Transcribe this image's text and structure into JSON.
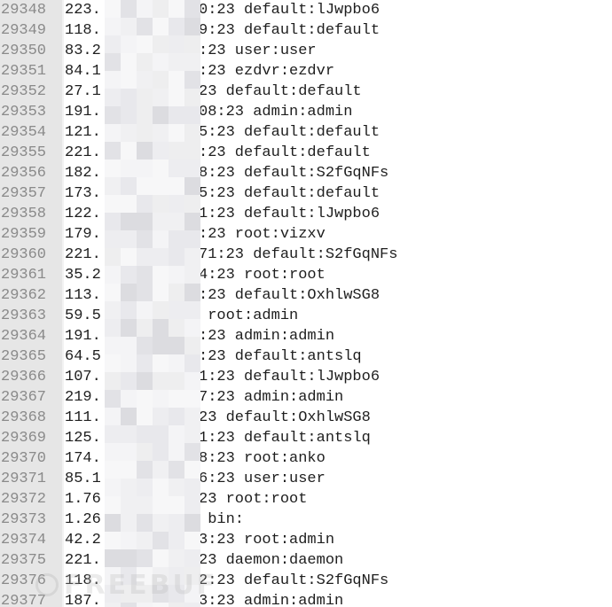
{
  "rows": [
    {
      "line": "29348",
      "ip": "223.",
      "rest": "0:23 default:lJwpbo6"
    },
    {
      "line": "29349",
      "ip": "118.",
      "rest": "9:23 default:default"
    },
    {
      "line": "29350",
      "ip": "83.2",
      "rest": ":23 user:user"
    },
    {
      "line": "29351",
      "ip": "84.1",
      "rest": ":23 ezdvr:ezdvr"
    },
    {
      "line": "29352",
      "ip": "27.1",
      "rest": "23 default:default"
    },
    {
      "line": "29353",
      "ip": "191.",
      "rest": "08:23 admin:admin"
    },
    {
      "line": "29354",
      "ip": "121.",
      "rest": "5:23 default:default"
    },
    {
      "line": "29355",
      "ip": "221.",
      "rest": ":23 default:default"
    },
    {
      "line": "29356",
      "ip": "182.",
      "rest": "8:23 default:S2fGqNFs"
    },
    {
      "line": "29357",
      "ip": "173.",
      "rest": "5:23 default:default"
    },
    {
      "line": "29358",
      "ip": "122.",
      "rest": "1:23 default:lJwpbo6"
    },
    {
      "line": "29359",
      "ip": "179.",
      "rest": ":23 root:vizxv"
    },
    {
      "line": "29360",
      "ip": "221.",
      "rest": "71:23 default:S2fGqNFs"
    },
    {
      "line": "29361",
      "ip": "35.2",
      "rest": "4:23 root:root"
    },
    {
      "line": "29362",
      "ip": "113.",
      "rest": ":23 default:OxhlwSG8"
    },
    {
      "line": "29363",
      "ip": "59.5",
      "rest": " root:admin"
    },
    {
      "line": "29364",
      "ip": "191.",
      "rest": ":23 admin:admin"
    },
    {
      "line": "29365",
      "ip": "64.5",
      "rest": ":23 default:antslq"
    },
    {
      "line": "29366",
      "ip": "107.",
      "rest": "1:23 default:lJwpbo6"
    },
    {
      "line": "29367",
      "ip": "219.",
      "rest": "7:23 admin:admin"
    },
    {
      "line": "29368",
      "ip": "111.",
      "rest": "23 default:OxhlwSG8"
    },
    {
      "line": "29369",
      "ip": "125.",
      "rest": "1:23 default:antslq"
    },
    {
      "line": "29370",
      "ip": "174.",
      "rest": "8:23 root:anko"
    },
    {
      "line": "29371",
      "ip": "85.1",
      "rest": "6:23 user:user"
    },
    {
      "line": "29372",
      "ip": "1.76",
      "rest": "23 root:root"
    },
    {
      "line": "29373",
      "ip": "1.26",
      "rest": " bin:"
    },
    {
      "line": "29374",
      "ip": "42.2",
      "rest": "3:23 root:admin"
    },
    {
      "line": "29375",
      "ip": "221.",
      "rest": "23 daemon:daemon"
    },
    {
      "line": "29376",
      "ip": "118.",
      "rest": "2:23 default:S2fGqNFs"
    },
    {
      "line": "29377",
      "ip": "187.",
      "rest": "3:23 admin:admin"
    }
  ],
  "watermark": {
    "text": "FREEBUF"
  },
  "colors": {
    "gutter_bg": "#e6e6e6",
    "line_number": "#8a8a8a",
    "text": "#1e1e1e"
  }
}
